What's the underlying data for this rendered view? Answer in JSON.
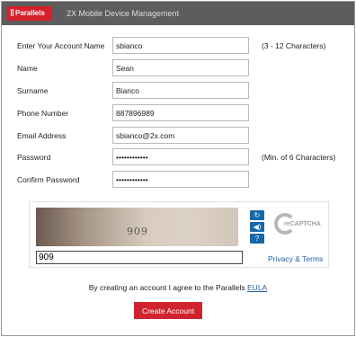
{
  "header": {
    "logo_text": "Parallels",
    "app_title": "2X Mobile Device Management"
  },
  "form": {
    "account_name": {
      "label": "Enter Your Account Name",
      "value": "sbianco",
      "hint": "(3 - 12 Characters)"
    },
    "name": {
      "label": "Name",
      "value": "Sean"
    },
    "surname": {
      "label": "Surname",
      "value": "Bianco"
    },
    "phone": {
      "label": "Phone Number",
      "value": "887896989"
    },
    "email": {
      "label": "Email Address",
      "value": "sbianco@2x.com"
    },
    "password": {
      "label": "Password",
      "value": "••••••••••••",
      "hint": "(Min. of 6 Characters)"
    },
    "confirm_password": {
      "label": "Confirm Password",
      "value": "••••••••••••"
    }
  },
  "captcha": {
    "image_word": "909",
    "input_value": "909",
    "refresh_icon": "refresh-icon",
    "audio_icon": "audio-icon",
    "help_icon": "help-icon",
    "logo_text": "reCAPTCHA",
    "privacy_link": "Privacy & Terms"
  },
  "agreement": {
    "text": "By creating an account I agree to the Parallels",
    "link": "EULA"
  },
  "create_button": "Create Account",
  "colors": {
    "brand_red": "#d0232e",
    "header_bg": "#5d5d5d",
    "link_blue": "#1f5fa6",
    "captcha_button_blue": "#1668a8"
  }
}
